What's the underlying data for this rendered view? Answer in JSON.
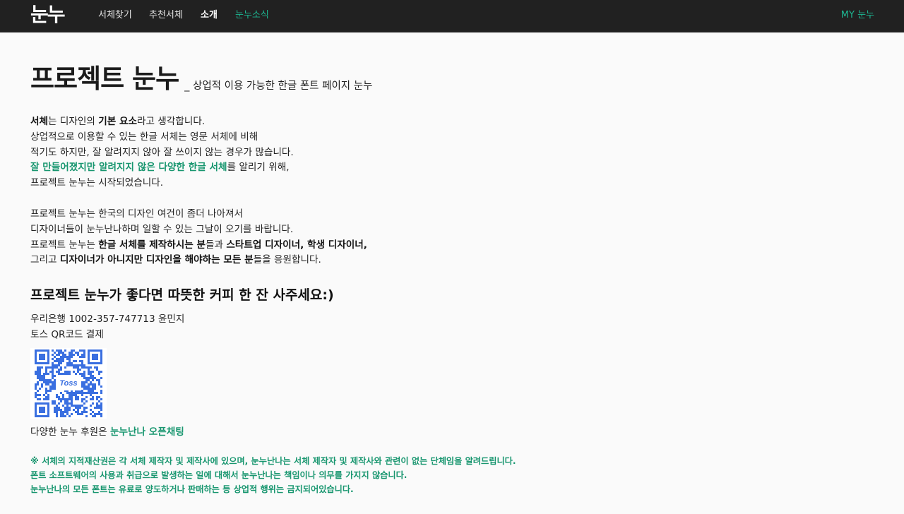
{
  "nav": {
    "logo": "눈누",
    "items": [
      {
        "label": "서체찾기"
      },
      {
        "label": "추천서체"
      },
      {
        "label": "소개"
      },
      {
        "label": "눈누소식"
      }
    ],
    "my": "MY 눈누"
  },
  "page": {
    "title": "프로젝트 눈누",
    "subtitle": "_ 상업적 이용 가능한 한글 폰트 페이지 눈누"
  },
  "intro": {
    "l1a": "서체",
    "l1b": "는 디자인의 ",
    "l1c": "기본 요소",
    "l1d": "라고 생각합니다.",
    "l2": "상업적으로 이용할 수 있는 한글 서체는 영문 서체에 비해",
    "l3": "적기도 하지만, 잘 알려지지 않아 잘 쓰이지 않는 경우가 많습니다.",
    "l4a": "잘 만들어졌지만 알려지지 않은 다양한 한글 서체",
    "l4b": "를 알리기 위해,",
    "l5": "프로젝트 눈누는 시작되었습니다."
  },
  "mission": {
    "l1": "프로젝트 눈누는 한국의 디자인 여건이 좀더 나아져서",
    "l2": "디자이너들이 눈누난나하며 일할 수 있는 그날이 오기를 바랍니다.",
    "l3a": "프로젝트 눈누는 ",
    "l3b": "한글 서체를 제작하시는 분",
    "l3c": "들과 ",
    "l3d": "스타트업 디자이너, 학생 디자이너,",
    "l4a": "그리고 ",
    "l4b": "디자이너가 아니지만 디자인을 해야하는 모든 분",
    "l4c": "들을 응원합니다."
  },
  "coffee": {
    "heading": "프로젝트 눈누가 좋다면 따뜻한 커피 한 잔 사주세요:)",
    "bank": "우리은행 1002-357-747713 윤민지",
    "toss": "토스 QR코드 결제",
    "qr_logo": "Toss"
  },
  "support": {
    "text": "다양한 눈누 후원은 ",
    "link": "눈누난나 오픈채팅"
  },
  "notice": {
    "l1": "※ 서체의 지적재산권은 각 서체 제작자 및 제작사에 있으며, 눈누난나는 서체 제작자 및 제작사와 관련이 없는 단체임을 알려드립니다.",
    "l2": "폰트 소프트웨어의 사용과 취급으로 발생하는 일에 대해서 눈누난나는 책임이나 의무를 가지지 않습니다.",
    "l3": "눈누난나의 모든 폰트는 유료로 양도하거나 판매하는 등 상업적 행위는 금지되어있습니다."
  },
  "colors": {
    "nav_bg": "#212121",
    "accent_green": "#18966f",
    "nav_accent": "#1db591",
    "qr_blue": "#3a6fe0"
  }
}
